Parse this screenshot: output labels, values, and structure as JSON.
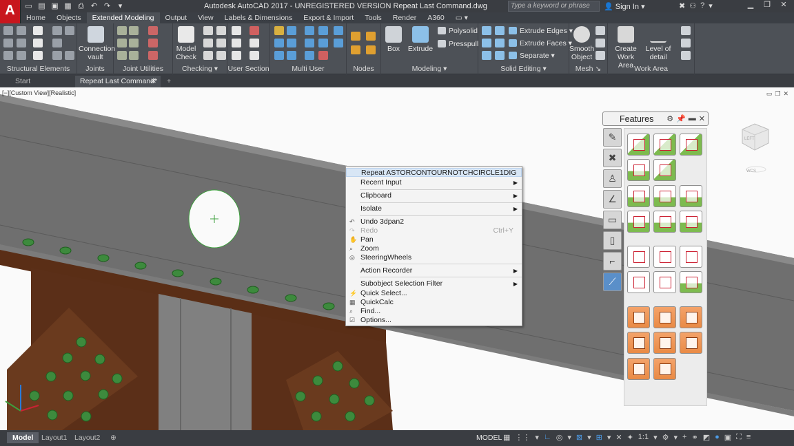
{
  "app": {
    "logo": "A",
    "title": "Autodesk AutoCAD 2017 - UNREGISTERED VERSION    Repeat Last Command.dwg",
    "search_placeholder": "Type a keyword or phrase",
    "signin": "Sign In"
  },
  "ribbon_tabs": [
    "Home",
    "Objects",
    "Extended Modeling",
    "Output",
    "View",
    "Labels & Dimensions",
    "Export & Import",
    "Tools",
    "Render",
    "A360"
  ],
  "ribbon_active_tab": "Extended Modeling",
  "panels": {
    "structural_elements": "Structural Elements",
    "joints": "Joints",
    "connection_vault": "Connection vault",
    "joint_utilities": "Joint Utilities",
    "model_check": "Model Check",
    "checking": "Checking",
    "user_section": "User Section",
    "multi_user": "Multi User",
    "nodes": "Nodes",
    "box": "Box",
    "extrude": "Extrude",
    "polysolid": "Polysolid",
    "presspull": "Presspull",
    "modeling": "Modeling",
    "extrude_edges": "Extrude Edges",
    "extrude_faces": "Extrude Faces",
    "separate": "Separate",
    "solid_editing": "Solid Editing",
    "smooth_object": "Smooth Object",
    "mesh": "Mesh",
    "create_work_area": "Create Work Area",
    "level_of_detail": "Level of detail",
    "work_area": "Work Area"
  },
  "doc_tabs": [
    "Start",
    "Repeat Last Command*"
  ],
  "viewport_label": "[−][Custom View][Realistic]",
  "context_menu": [
    {
      "label": "Repeat ASTORCONTOURNOTCHCIRCLE1DIG",
      "highlight": true
    },
    {
      "label": "Recent Input",
      "submenu": true
    },
    {
      "label": "Clipboard",
      "submenu": true
    },
    {
      "label": "Isolate",
      "submenu": true
    },
    {
      "label": "Undo 3dpan2",
      "icon": "undo-icon"
    },
    {
      "label": "Redo",
      "shortcut": "Ctrl+Y",
      "disabled": true,
      "icon": "redo-icon"
    },
    {
      "label": "Pan",
      "icon": "pan-icon"
    },
    {
      "label": "Zoom",
      "icon": "zoom-icon"
    },
    {
      "label": "SteeringWheels",
      "icon": "steering-wheel-icon"
    },
    {
      "label": "Action Recorder",
      "submenu": true
    },
    {
      "label": "Subobject Selection Filter",
      "submenu": true
    },
    {
      "label": "Quick Select...",
      "icon": "quick-select-icon"
    },
    {
      "label": "QuickCalc",
      "icon": "calculator-icon"
    },
    {
      "label": "Find...",
      "icon": "find-icon"
    },
    {
      "label": "Options...",
      "icon": "options-icon"
    }
  ],
  "features": {
    "title": "Features"
  },
  "viewcube": {
    "face_label": "LEFT",
    "wcs_label": "WCS"
  },
  "status": {
    "layout_tabs": [
      "Model",
      "Layout1",
      "Layout2"
    ],
    "model_label": "MODEL",
    "scale": "1:1"
  }
}
